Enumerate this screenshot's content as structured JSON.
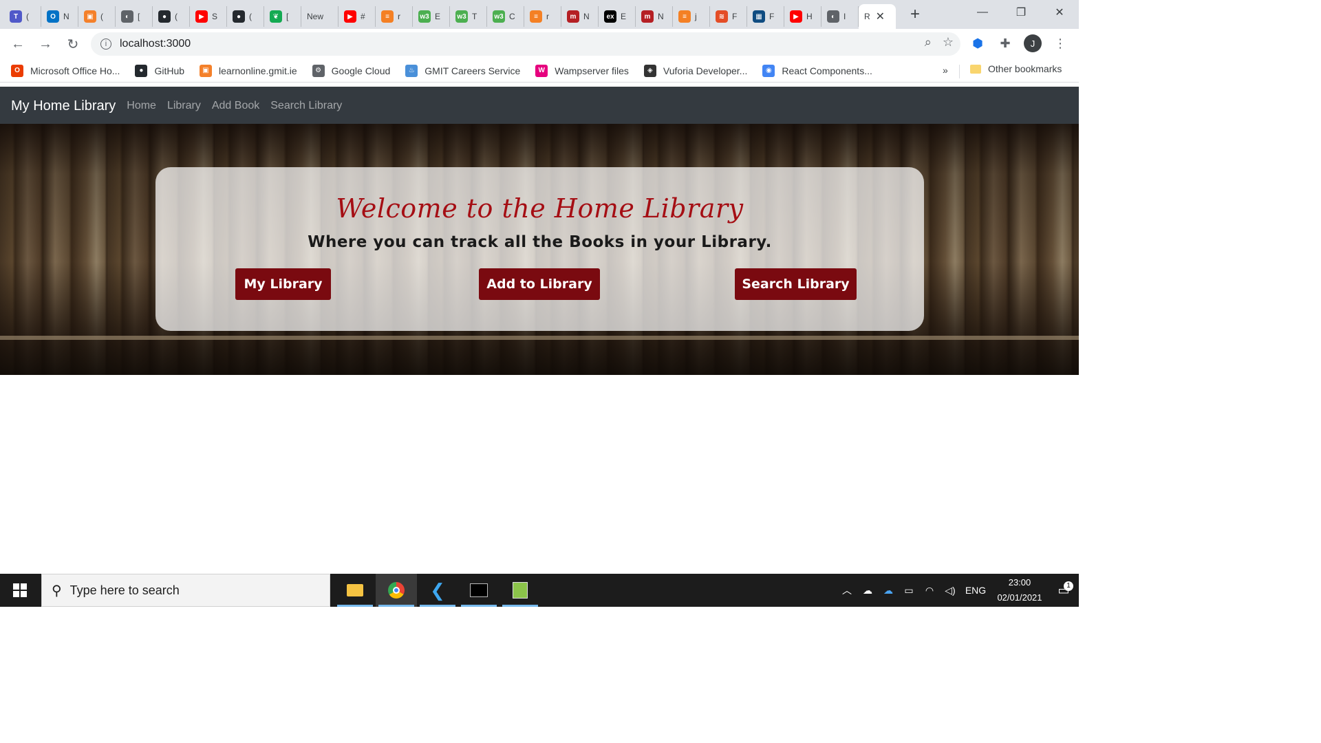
{
  "browser": {
    "tabs": [
      {
        "label": "(",
        "fav_color": "#5059c9",
        "fav_glyph": "T"
      },
      {
        "label": "N",
        "fav_color": "#0072c6",
        "fav_glyph": "O"
      },
      {
        "label": "(",
        "fav_color": "#f4802a",
        "fav_glyph": "▣"
      },
      {
        "label": "[",
        "fav_color": "#5f6368",
        "fav_glyph": "◐"
      },
      {
        "label": "(",
        "fav_color": "#24292e",
        "fav_glyph": "●"
      },
      {
        "label": "S",
        "fav_color": "#ff0000",
        "fav_glyph": "▶"
      },
      {
        "label": "(",
        "fav_color": "#24292e",
        "fav_glyph": "●"
      },
      {
        "label": "[",
        "fav_color": "#13aa52",
        "fav_glyph": "❦"
      },
      {
        "label": "New",
        "fav_color": "",
        "fav_glyph": ""
      },
      {
        "label": "#",
        "fav_color": "#ff0000",
        "fav_glyph": "▶"
      },
      {
        "label": "r",
        "fav_color": "#f48024",
        "fav_glyph": "≡"
      },
      {
        "label": "E",
        "fav_color": "#4caf50",
        "fav_glyph": "w3"
      },
      {
        "label": "T",
        "fav_color": "#4caf50",
        "fav_glyph": "w3"
      },
      {
        "label": "C",
        "fav_color": "#4caf50",
        "fav_glyph": "w3"
      },
      {
        "label": "r",
        "fav_color": "#f48024",
        "fav_glyph": "≡"
      },
      {
        "label": "N",
        "fav_color": "#b51f24",
        "fav_glyph": "m"
      },
      {
        "label": "E",
        "fav_color": "#000000",
        "fav_glyph": "ex"
      },
      {
        "label": "N",
        "fav_color": "#b51f24",
        "fav_glyph": "m"
      },
      {
        "label": "j",
        "fav_color": "#f48024",
        "fav_glyph": "≡"
      },
      {
        "label": "F",
        "fav_color": "#e44d26",
        "fav_glyph": "≋"
      },
      {
        "label": "F",
        "fav_color": "#0f4c81",
        "fav_glyph": "▦"
      },
      {
        "label": "H",
        "fav_color": "#ff0000",
        "fav_glyph": "▶"
      },
      {
        "label": "I",
        "fav_color": "#5f6368",
        "fav_glyph": "◐"
      }
    ],
    "active_tab_label": "R",
    "url": "localhost:3000",
    "profile_initial": "J"
  },
  "bookmarks": [
    {
      "label": "Microsoft Office Ho...",
      "color": "#eb3c00",
      "glyph": "O"
    },
    {
      "label": "GitHub",
      "color": "#24292e",
      "glyph": "●"
    },
    {
      "label": "learnonline.gmit.ie",
      "color": "#f4802a",
      "glyph": "▣"
    },
    {
      "label": "Google Cloud",
      "color": "#5f6368",
      "glyph": "⚙"
    },
    {
      "label": "GMIT Careers Service",
      "color": "#4a90d9",
      "glyph": "♨"
    },
    {
      "label": "Wampserver files",
      "color": "#e6007e",
      "glyph": "W"
    },
    {
      "label": "Vuforia Developer...",
      "color": "#333333",
      "glyph": "◈"
    },
    {
      "label": "React Components...",
      "color": "#4285f4",
      "glyph": "◉"
    }
  ],
  "bookmarks_more": "»",
  "other_bookmarks": "Other bookmarks",
  "app": {
    "brand": "My Home Library",
    "nav": [
      "Home",
      "Library",
      "Add Book",
      "Search Library"
    ],
    "hero": {
      "title": "Welcome to the Home Library",
      "subtitle": "Where you can track all the Books in your Library.",
      "buttons": [
        "My Library",
        "Add to Library",
        "Search Library"
      ]
    }
  },
  "taskbar": {
    "search_placeholder": "Type here to search",
    "language": "ENG",
    "time": "23:00",
    "date": "02/01/2021",
    "notification_count": "1"
  }
}
